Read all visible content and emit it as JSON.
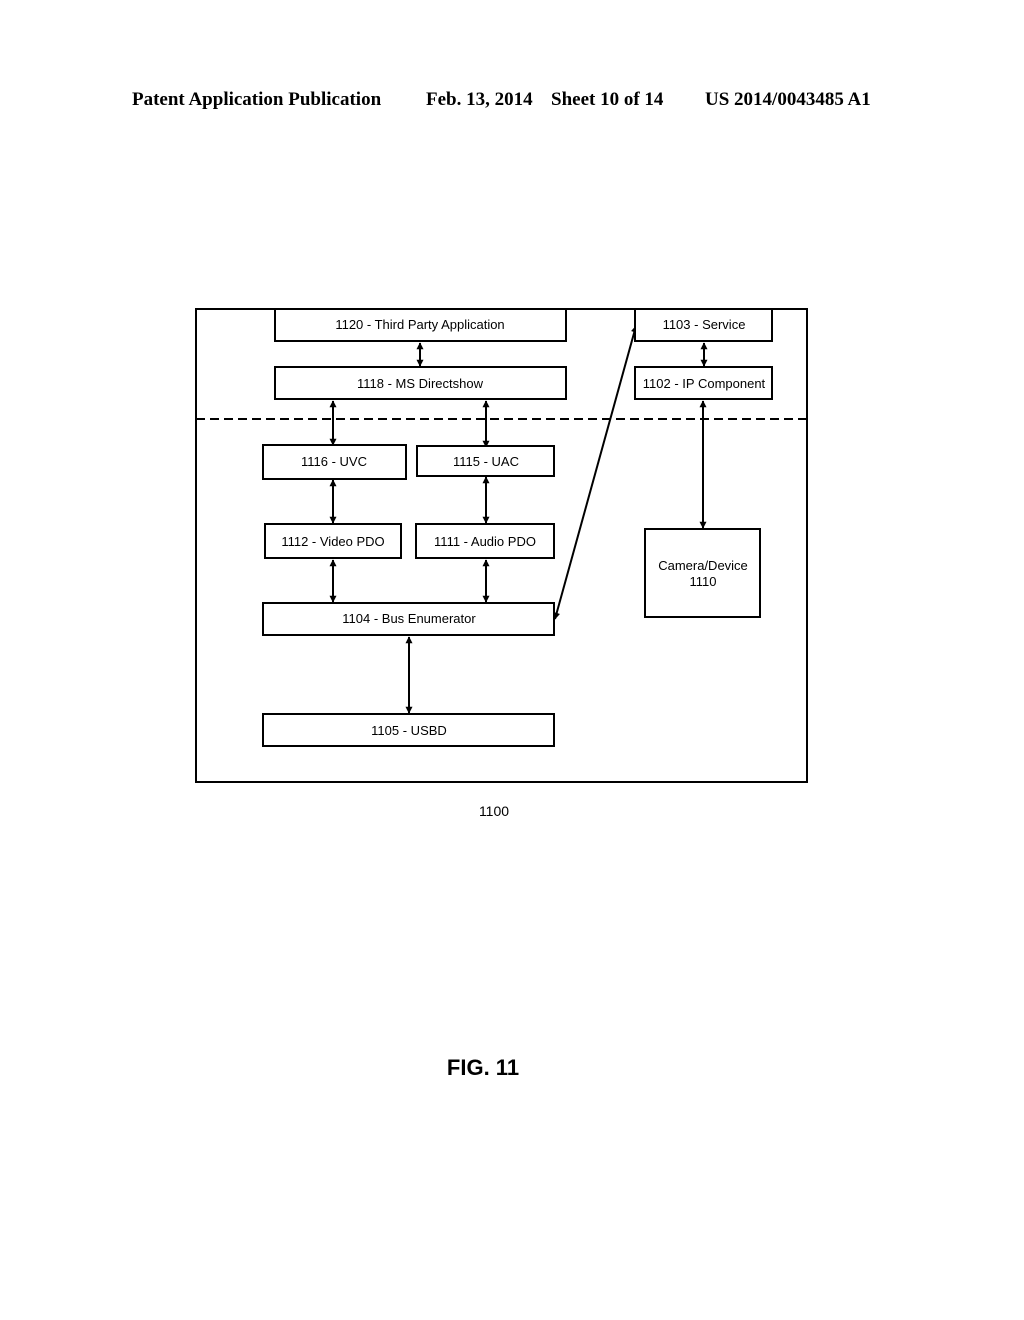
{
  "header": {
    "publication": "Patent Application Publication",
    "date": "Feb. 13, 2014",
    "sheet": "Sheet 10 of 14",
    "number": "US 2014/0043485 A1"
  },
  "diagram": {
    "blocks": {
      "third_party_app": "1120 - Third Party Application",
      "ms_directshow": "1118 - MS Directshow",
      "uvc": "1116 - UVC",
      "uac": "1115 - UAC",
      "video_pdo": "1112 - Video PDO",
      "audio_pdo": "1111 - Audio PDO",
      "bus_enumerator": "1104 - Bus Enumerator",
      "usbd": "1105 - USBD",
      "service": "1103 - Service",
      "ip_component": "1102 - IP Component",
      "camera_line1": "Camera/Device",
      "camera_line2": "1110"
    },
    "system_label": "1100",
    "connections": [
      [
        "1120 - Third Party Application",
        "1118 - MS Directshow"
      ],
      [
        "1118 - MS Directshow",
        "1116 - UVC"
      ],
      [
        "1118 - MS Directshow",
        "1115 - UAC"
      ],
      [
        "1116 - UVC",
        "1112 - Video PDO"
      ],
      [
        "1115 - UAC",
        "1111 - Audio PDO"
      ],
      [
        "1112 - Video PDO",
        "1104 - Bus Enumerator"
      ],
      [
        "1111 - Audio PDO",
        "1104 - Bus Enumerator"
      ],
      [
        "1104 - Bus Enumerator",
        "1105 - USBD"
      ],
      [
        "1104 - Bus Enumerator",
        "1103 - Service"
      ],
      [
        "1103 - Service",
        "1102 - IP Component"
      ],
      [
        "1102 - IP Component",
        "Camera/Device 1110"
      ]
    ]
  },
  "figure_label": "FIG. 11"
}
